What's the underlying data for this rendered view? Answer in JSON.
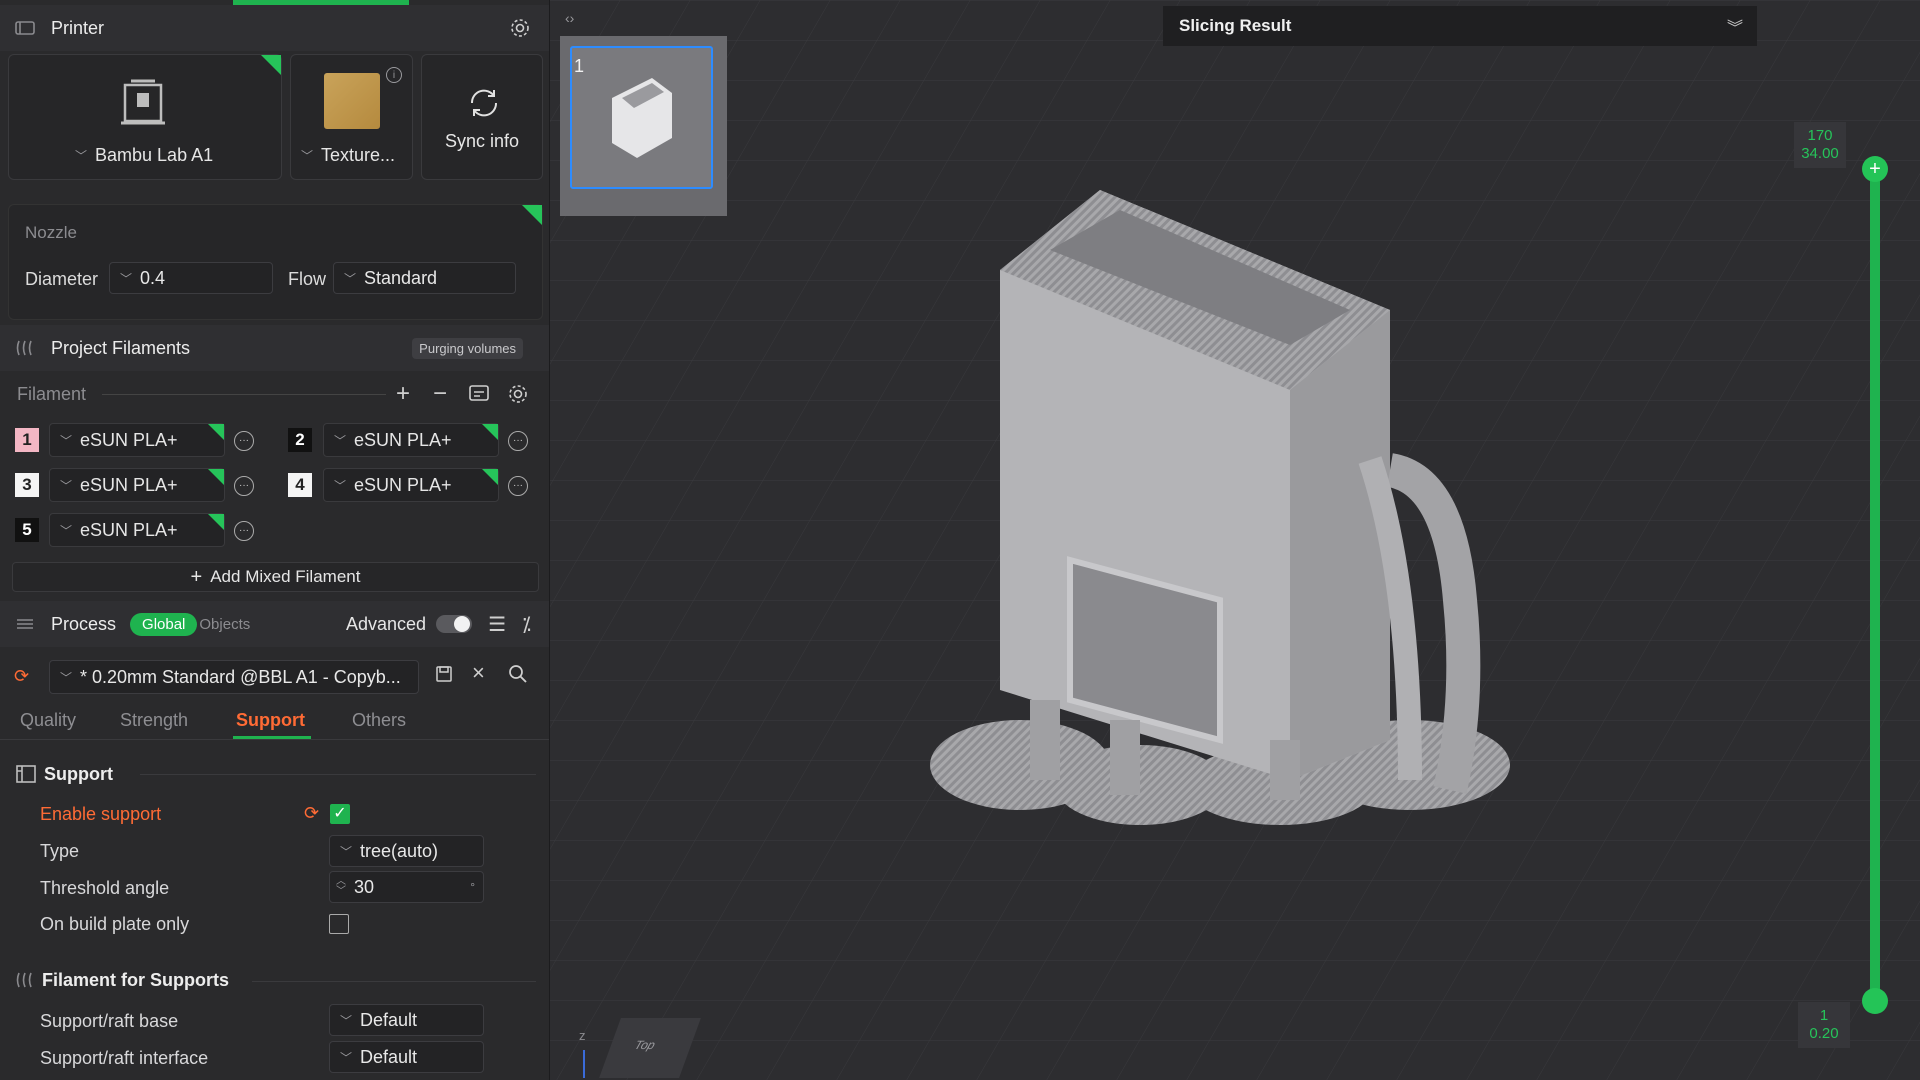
{
  "printer": {
    "section_title": "Printer",
    "printer_name": "Bambu Lab A1",
    "plate_name": "Texture...",
    "sync_label": "Sync info"
  },
  "nozzle": {
    "title": "Nozzle",
    "diameter_label": "Diameter",
    "diameter_value": "0.4",
    "flow_label": "Flow",
    "flow_value": "Standard"
  },
  "filaments": {
    "section_title": "Project Filaments",
    "purging_label": "Purging volumes",
    "filament_label": "Filament",
    "items": [
      {
        "num": "1",
        "name": "eSUN PLA+",
        "color": "#f3b6c4"
      },
      {
        "num": "2",
        "name": "eSUN PLA+",
        "color": "#111111"
      },
      {
        "num": "3",
        "name": "eSUN PLA+",
        "color": "#f4f4f4"
      },
      {
        "num": "4",
        "name": "eSUN PLA+",
        "color": "#f4f4f4"
      },
      {
        "num": "5",
        "name": "eSUN PLA+",
        "color": "#111111"
      }
    ],
    "add_mixed_label": "Add Mixed Filament"
  },
  "process": {
    "section_title": "Process",
    "global_label": "Global",
    "objects_label": "Objects",
    "advanced_label": "Advanced",
    "preset_value": "* 0.20mm Standard @BBL A1 - Copyb...",
    "tabs": [
      "Quality",
      "Strength",
      "Support",
      "Others"
    ],
    "active_tab": "Support"
  },
  "support": {
    "section_title": "Support",
    "enable_label": "Enable support",
    "enable_checked": true,
    "type_label": "Type",
    "type_value": "tree(auto)",
    "threshold_label": "Threshold angle",
    "threshold_value": "30",
    "threshold_unit": "°",
    "build_plate_label": "On build plate only",
    "build_plate_checked": false
  },
  "filament_supports": {
    "section_title": "Filament for Supports",
    "base_label": "Support/raft base",
    "base_value": "Default",
    "interface_label": "Support/raft interface",
    "interface_value": "Default"
  },
  "viewport": {
    "slicing_title": "Slicing Result",
    "plate_number": "1",
    "slider_top_layer": "170",
    "slider_top_height": "34.00",
    "slider_bottom_layer": "1",
    "slider_bottom_height": "0.20",
    "axis_z": "z",
    "cube_label": "Top"
  },
  "colors": {
    "accent_green": "#1fb34f",
    "accent_orange": "#ff6b35",
    "selection_blue": "#2d8cff"
  }
}
